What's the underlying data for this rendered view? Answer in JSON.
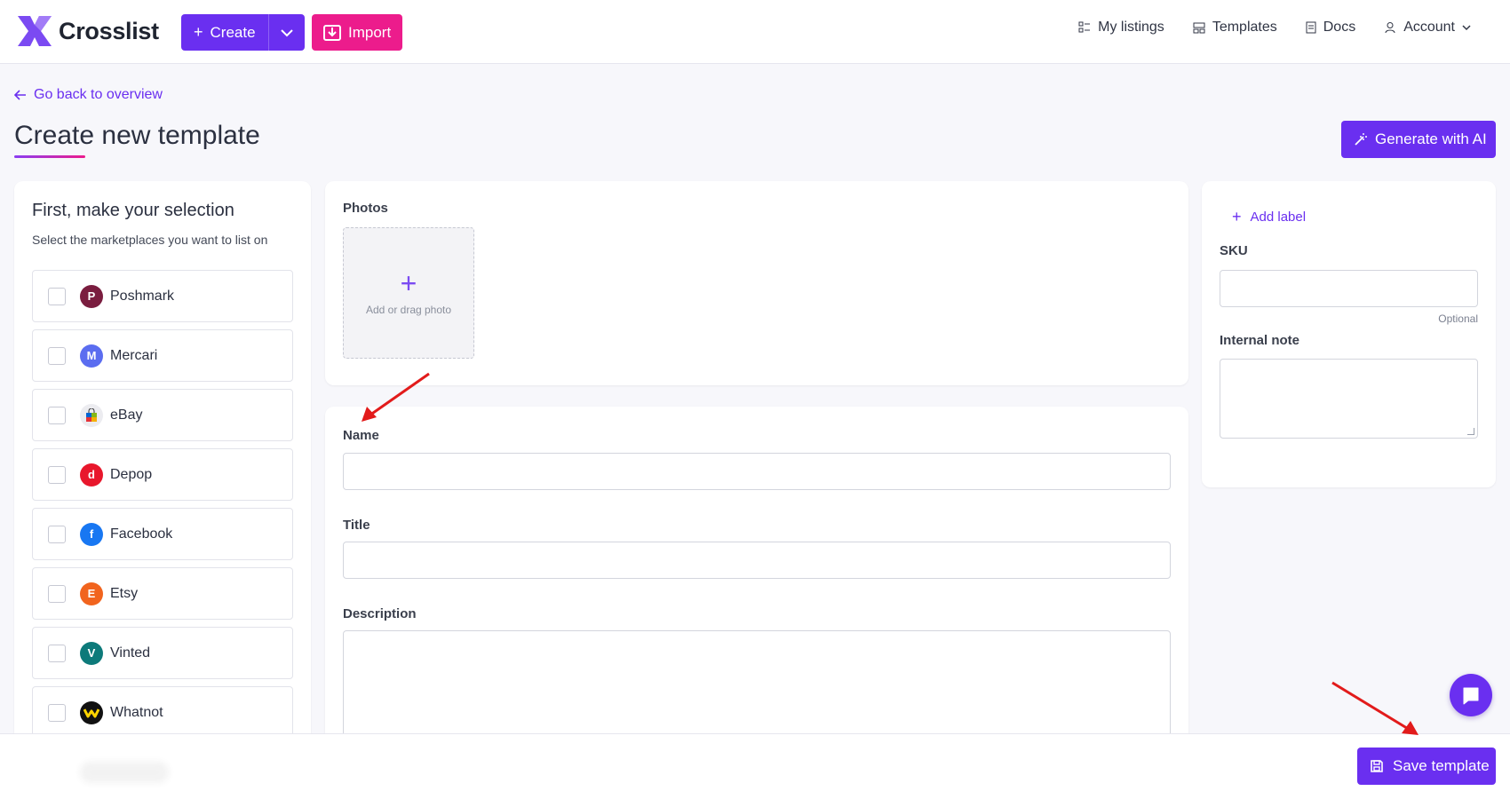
{
  "header": {
    "logo_text": "Crosslist",
    "create_label": "Create",
    "import_label": "Import",
    "nav": [
      {
        "label": "My listings",
        "icon": "list-icon"
      },
      {
        "label": "Templates",
        "icon": "template-icon"
      },
      {
        "label": "Docs",
        "icon": "document-icon"
      },
      {
        "label": "Account",
        "icon": "user-icon"
      }
    ]
  },
  "page": {
    "back_label": "Go back to overview",
    "title": "Create new template",
    "generate_ai_label": "Generate with AI"
  },
  "marketplaces": {
    "title": "First, make your selection",
    "subtitle": "Select the marketplaces you want to list on",
    "items": [
      {
        "label": "Poshmark",
        "color": "#7a1d3f"
      },
      {
        "label": "Mercari",
        "color": "#5b6df0"
      },
      {
        "label": "eBay",
        "color": "#e8e8ec"
      },
      {
        "label": "Depop",
        "color": "#e8172c"
      },
      {
        "label": "Facebook",
        "color": "#1877f2"
      },
      {
        "label": "Etsy",
        "color": "#f1641e"
      },
      {
        "label": "Vinted",
        "color": "#0d7a7a"
      },
      {
        "label": "Whatnot",
        "color": "#111111"
      }
    ]
  },
  "photos": {
    "label": "Photos",
    "drop_text": "Add or drag photo"
  },
  "form": {
    "name_label": "Name",
    "title_label": "Title",
    "description_label": "Description"
  },
  "sidebar": {
    "add_label": "Add label",
    "sku_label": "SKU",
    "sku_hint": "Optional",
    "note_label": "Internal note"
  },
  "footer": {
    "save_label": "Save template"
  },
  "colors": {
    "primary": "#6a2ff0",
    "accent": "#ec1c8c",
    "annotation_arrow": "#e21b1b"
  }
}
